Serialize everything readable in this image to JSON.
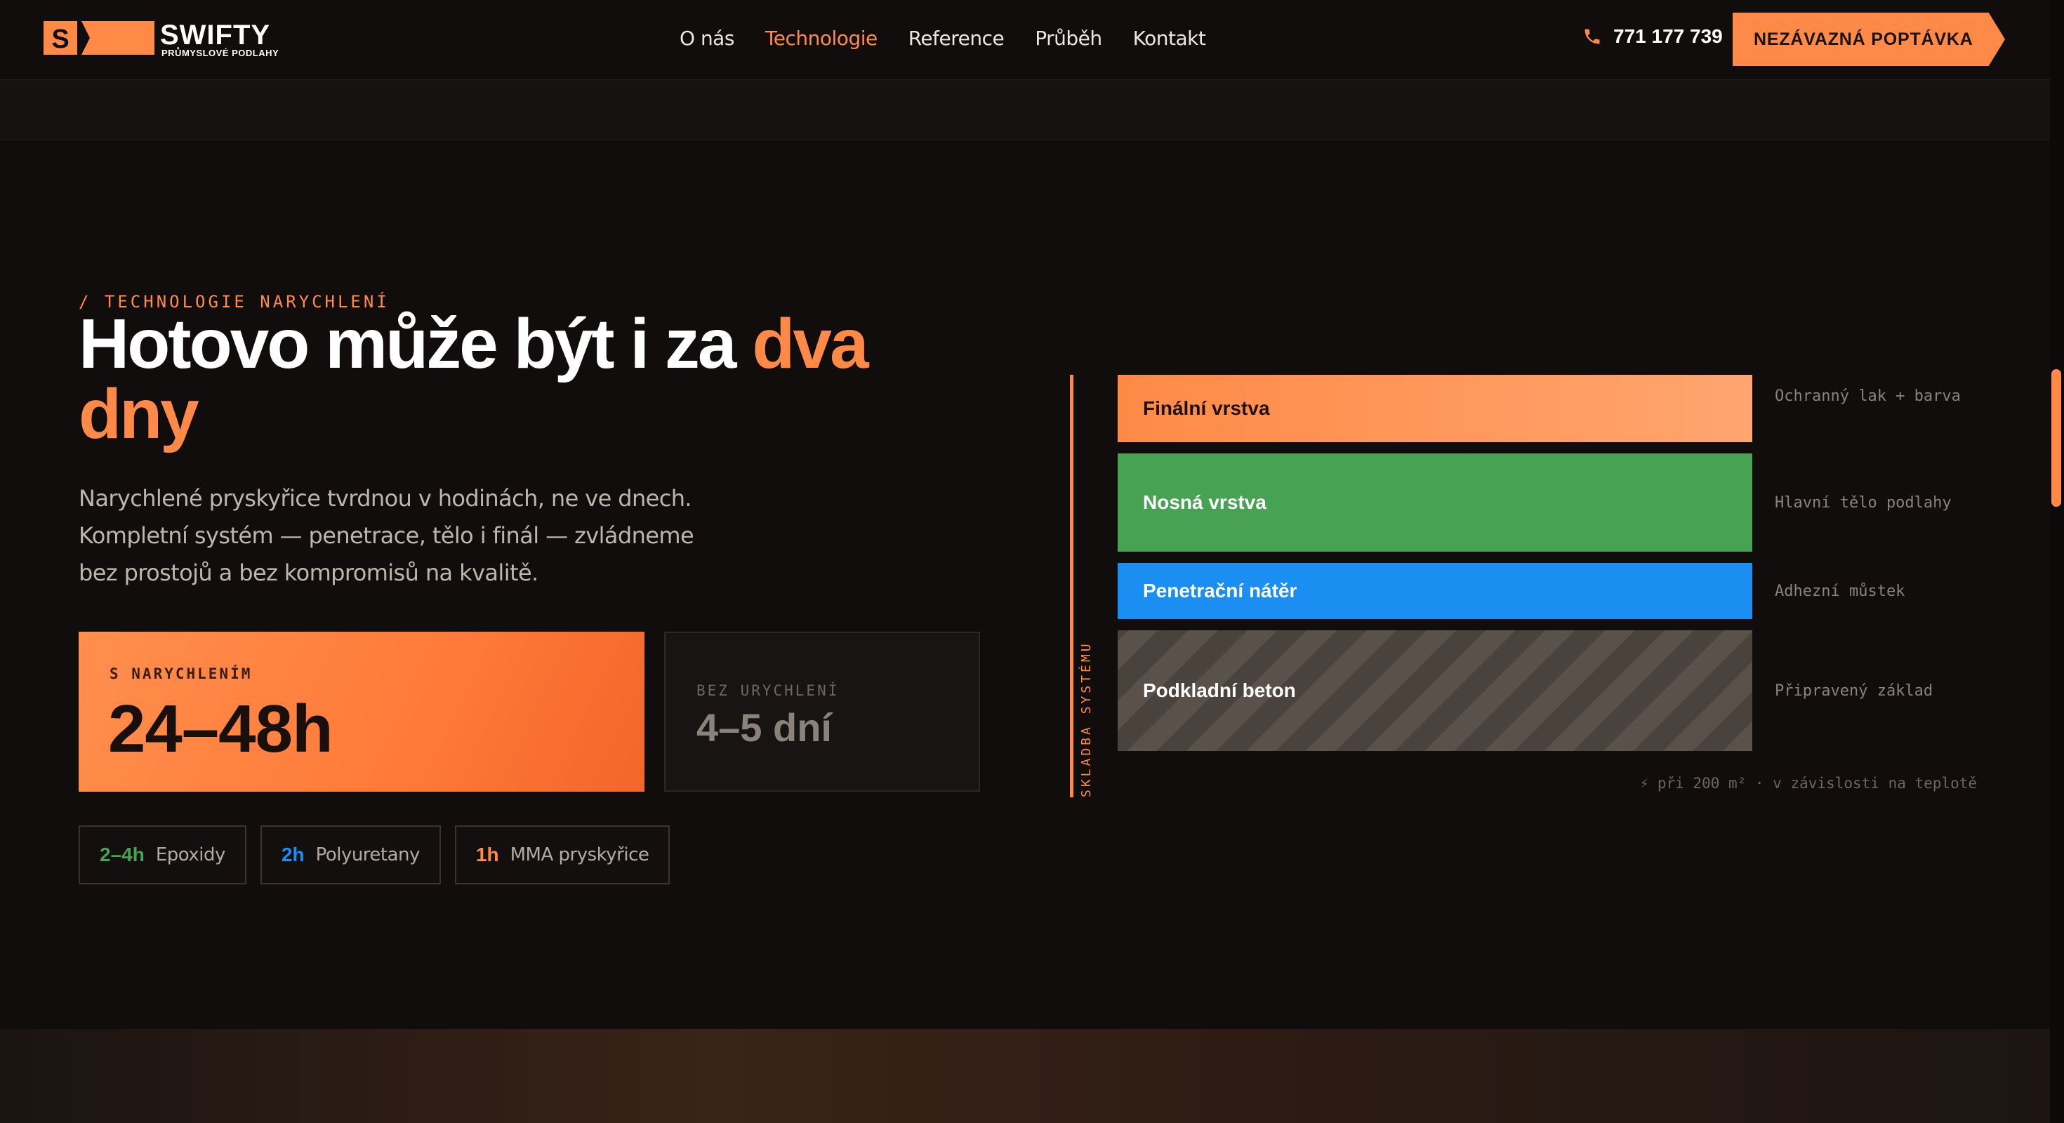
{
  "brand": {
    "name": "SWIFTY",
    "tagline": "PRŮMYSLOVÉ PODLAHY",
    "mark_letter": "S",
    "accent_color": "#ff8a47"
  },
  "nav": {
    "items": [
      {
        "label": "O nás",
        "active": false
      },
      {
        "label": "Technologie",
        "active": true
      },
      {
        "label": "Reference",
        "active": false
      },
      {
        "label": "Průběh",
        "active": false
      },
      {
        "label": "Kontakt",
        "active": false
      }
    ]
  },
  "header": {
    "phone_icon": "phone-icon",
    "phone": "771 177 739",
    "cta_label": "NEZÁVAZNÁ POPTÁVKA"
  },
  "hero": {
    "eyebrow": "/ TECHNOLOGIE NARYCHLENÍ",
    "headline_main": "Hotovo může být i za ",
    "headline_accent": "dva dny",
    "lead": "Narychlené pryskyřice tvrdnou v hodinách, ne ve dnech. Kompletní systém — penetrace, tělo i finál — zvládneme bez prostojů a bez kompromisů na kvalitě.",
    "fast": {
      "label": "S NARYCHLENÍM",
      "value": "24–48h"
    },
    "slow": {
      "label": "BEZ URYCHLENÍ",
      "value": "4–5 dní"
    },
    "chips": [
      {
        "time": "2–4h",
        "name": "Epoxidy",
        "color": "#47a353"
      },
      {
        "time": "2h",
        "name": "Polyuretany",
        "color": "#1b8ef2"
      },
      {
        "time": "1h",
        "name": "MMA pryskyřice",
        "color": "#ff8a47"
      }
    ]
  },
  "diagram": {
    "axis_label": "SKLADBA SYSTÉMU",
    "layers": [
      {
        "name": "Finální vrstva",
        "note": "Ochranný lak + barva",
        "color": "#ff8a47"
      },
      {
        "name": "Nosná vrstva",
        "note": "Hlavní tělo podlahy",
        "color": "#47a353"
      },
      {
        "name": "Penetrační nátěr",
        "note": "Adhezní můstek",
        "color": "#1b8ef2"
      },
      {
        "name": "Podkladní beton",
        "note": "Připravený základ",
        "color": "#5a514b"
      }
    ],
    "footnote": "⚡ při 200 m² · v závislosti na teplotě"
  }
}
